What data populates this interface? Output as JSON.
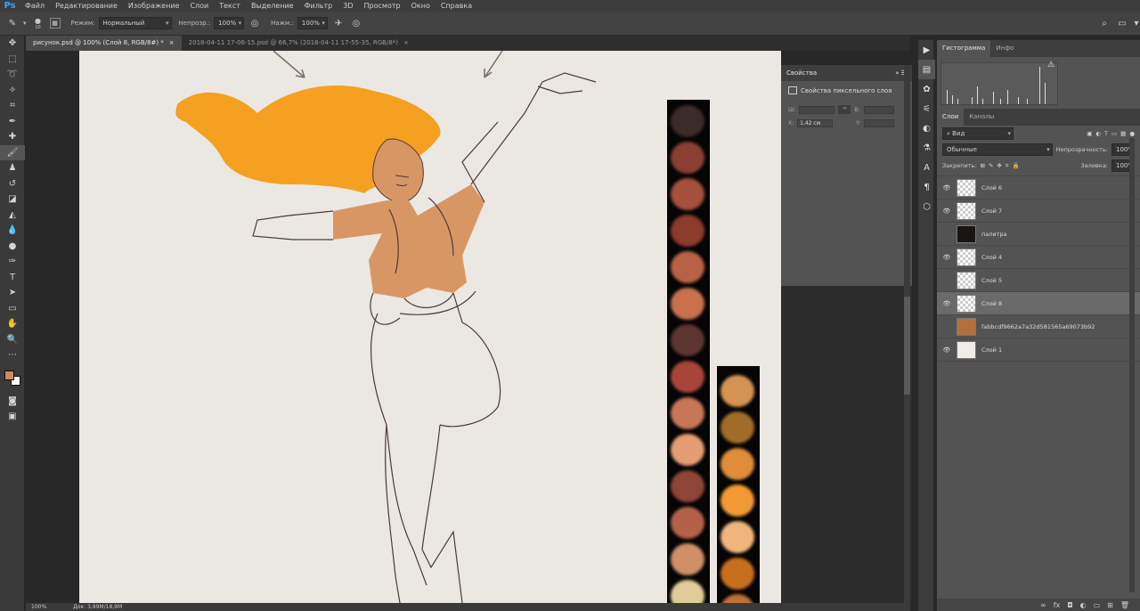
{
  "app": {
    "logo": "Ps"
  },
  "menu": [
    "Файл",
    "Редактирование",
    "Изображение",
    "Слои",
    "Текст",
    "Выделение",
    "Фильтр",
    "3D",
    "Просмотр",
    "Окно",
    "Справка"
  ],
  "options": {
    "brush_size": "10",
    "mode_label": "Режим:",
    "mode_value": "Нормальный",
    "opacity_label": "Непрозр.:",
    "opacity_value": "100%",
    "flow_label": "Нажм.:",
    "flow_value": "100%"
  },
  "tabs": [
    {
      "label": "рисунок.psd @ 100% (Слой 8, RGB/8#) *",
      "active": true
    },
    {
      "label": "2018-04-11 17-06-15.psd @ 66,7% (2018-04-11 17-55-35, RGB/8*)",
      "active": false
    }
  ],
  "status": {
    "zoom": "100%",
    "doc": "Док: 3,99M/18,9M"
  },
  "properties": {
    "tab": "Свойства",
    "title": "Свойства пиксельного слоя",
    "w_label": "Ш:",
    "h_label": "В:",
    "x_label": "X:",
    "x_value": "1,42 см",
    "y_label": "Y:"
  },
  "histogram_tabs": [
    "Гистограмма",
    "Инфо"
  ],
  "layers_tabs": [
    "Слои",
    "Каналы"
  ],
  "layers_panel": {
    "filter_label": "Вид",
    "blend_mode": "Обычные",
    "opacity_label": "Непрозрачность:",
    "opacity_value": "100%",
    "lock_label": "Закрепить:",
    "fill_label": "Заливка:",
    "fill_value": "100%"
  },
  "layers": [
    {
      "name": "Слой 6",
      "visible": true,
      "thumb": "transparent"
    },
    {
      "name": "Слой 7",
      "visible": true,
      "thumb": "transparent"
    },
    {
      "name": "палитра",
      "visible": false,
      "thumb": "dark"
    },
    {
      "name": "Слой 4",
      "visible": true,
      "thumb": "transparent"
    },
    {
      "name": "Слой 5",
      "visible": false,
      "thumb": "transparent"
    },
    {
      "name": "Слой 8",
      "visible": true,
      "thumb": "transparent",
      "selected": true
    },
    {
      "name": "fabbcdf9662a7a32d581565a69073b92",
      "visible": false,
      "thumb": "photo"
    },
    {
      "name": "Слой 1",
      "visible": true,
      "thumb": "white"
    }
  ],
  "palette_left": [
    "#3b2b2a",
    "#8a3f33",
    "#a4503d",
    "#8c3b2c",
    "#b86245",
    "#c9714d",
    "#5d3531",
    "#a8443a",
    "#c77657",
    "#e59e74",
    "#8e4537",
    "#b46247",
    "#d08f67",
    "#e1cb98"
  ],
  "palette_right": [
    "#d59352",
    "#a06c27",
    "#e08d3a",
    "#f19a33",
    "#f1b67d",
    "#c86f1f",
    "#c36f3a"
  ],
  "colors": {
    "foreground": "#d18a5e",
    "background": "#ffffff",
    "hair": "#f5a020",
    "skin": "#d99665"
  }
}
